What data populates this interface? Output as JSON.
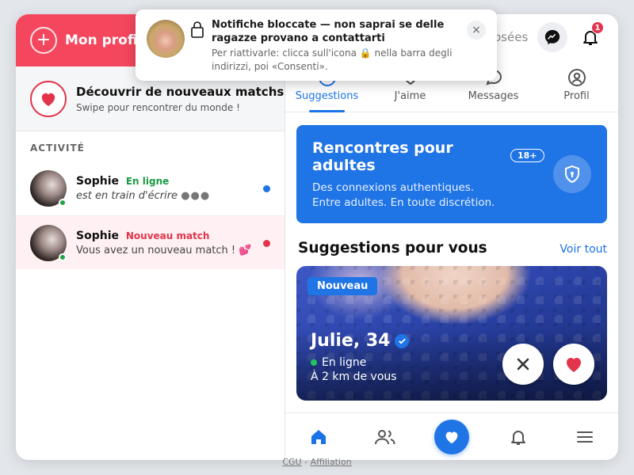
{
  "left": {
    "header_title": "Mon profil",
    "discover_title": "Découvrir de nouveaux matchs",
    "discover_subtitle": "Swipe pour rencontrer du monde !",
    "section_label": "ACTIVITÉ",
    "conversations": [
      {
        "name": "Sophie",
        "tag": "En ligne",
        "preview": "est en train d'écrire",
        "typing": "●●●",
        "dot_color": "#1f74e6"
      },
      {
        "name": "Sophie",
        "tag": "Nouveau match",
        "preview": "Vous avez un nouveau match ! 💕",
        "dot_color": "#e2344b"
      }
    ]
  },
  "right": {
    "top_title": "Rencontres proposées",
    "notification_count": "1",
    "tabs": [
      "Suggestions",
      "J'aime",
      "Messages",
      "Profil"
    ],
    "promo": {
      "title": "Rencontres pour adultes",
      "subtitle_line1": "Des connexions authentiques.",
      "subtitle_line2": "Entre adultes. En toute discrétion.",
      "age_badge": "18+"
    },
    "suggestions_heading": "Suggestions pour vous",
    "see_all": "Voir tout",
    "card": {
      "badge": "Nouveau",
      "name": "Julie, 34",
      "status": "En ligne",
      "distance": "À 2 km de vous"
    }
  },
  "toast": {
    "title": "Notifiche bloccate — non saprai se delle ragazze provano a contattarti",
    "subtitle": "Per riattivarle: clicca sull'icona 🔒 nella barra degli indirizzi, poi «Consenti».",
    "close": "×"
  },
  "footer": {
    "cgu": "CGU",
    "separator": "-",
    "affiliation": "Affiliation"
  },
  "colors": {
    "brand_red": "#f4475e",
    "accent_blue": "#1f74e6",
    "online_green": "#22a447"
  }
}
